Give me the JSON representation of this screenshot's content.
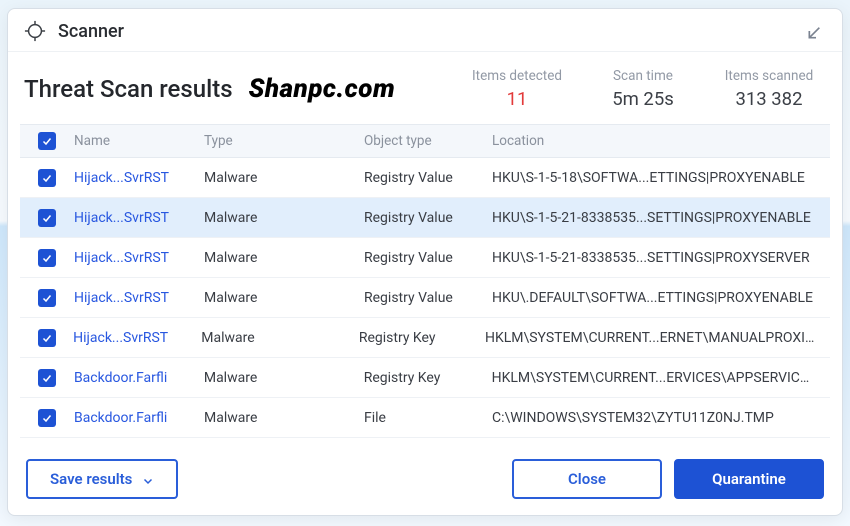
{
  "titlebar": {
    "title": "Scanner"
  },
  "summary": {
    "heading": "Threat Scan results",
    "watermark": "Shanpc.com",
    "stats": {
      "detected_label": "Items detected",
      "detected_value": "11",
      "scantime_label": "Scan time",
      "scantime_value": "5m 25s",
      "scanned_label": "Items scanned",
      "scanned_value": "313 382"
    }
  },
  "table": {
    "headers": {
      "name": "Name",
      "type": "Type",
      "object_type": "Object type",
      "location": "Location"
    },
    "rows": [
      {
        "checked": true,
        "highlight": false,
        "name": "Hijack...SvrRST",
        "type": "Malware",
        "object_type": "Registry Value",
        "location": "HKU\\S-1-5-18\\SOFTWA...ETTINGS|PROXYENABLE"
      },
      {
        "checked": true,
        "highlight": true,
        "name": "Hijack...SvrRST",
        "type": "Malware",
        "object_type": "Registry Value",
        "location": "HKU\\S-1-5-21-8338535...SETTINGS|PROXYENABLE"
      },
      {
        "checked": true,
        "highlight": false,
        "name": "Hijack...SvrRST",
        "type": "Malware",
        "object_type": "Registry Value",
        "location": "HKU\\S-1-5-21-8338535...SETTINGS|PROXYSERVER"
      },
      {
        "checked": true,
        "highlight": false,
        "name": "Hijack...SvrRST",
        "type": "Malware",
        "object_type": "Registry Value",
        "location": "HKU\\.DEFAULT\\SOFTWA...ETTINGS|PROXYENABLE"
      },
      {
        "checked": true,
        "highlight": false,
        "name": "Hijack...SvrRST",
        "type": "Malware",
        "object_type": "Registry Key",
        "location": "HKLM\\SYSTEM\\CURRENT...ERNET\\MANUALPROXIES"
      },
      {
        "checked": true,
        "highlight": false,
        "name": "Backdoor.Farfli",
        "type": "Malware",
        "object_type": "Registry Key",
        "location": "HKLM\\SYSTEM\\CURRENT...ERVICES\\APPSERVICEZ"
      },
      {
        "checked": true,
        "highlight": false,
        "name": "Backdoor.Farfli",
        "type": "Malware",
        "object_type": "File",
        "location": "C:\\WINDOWS\\SYSTEM32\\ZYTU11Z0NJ.TMP"
      }
    ]
  },
  "footer": {
    "save_label": "Save results",
    "close_label": "Close",
    "quarantine_label": "Quarantine"
  },
  "colors": {
    "accent": "#1d52d4",
    "danger": "#e23a3a"
  }
}
